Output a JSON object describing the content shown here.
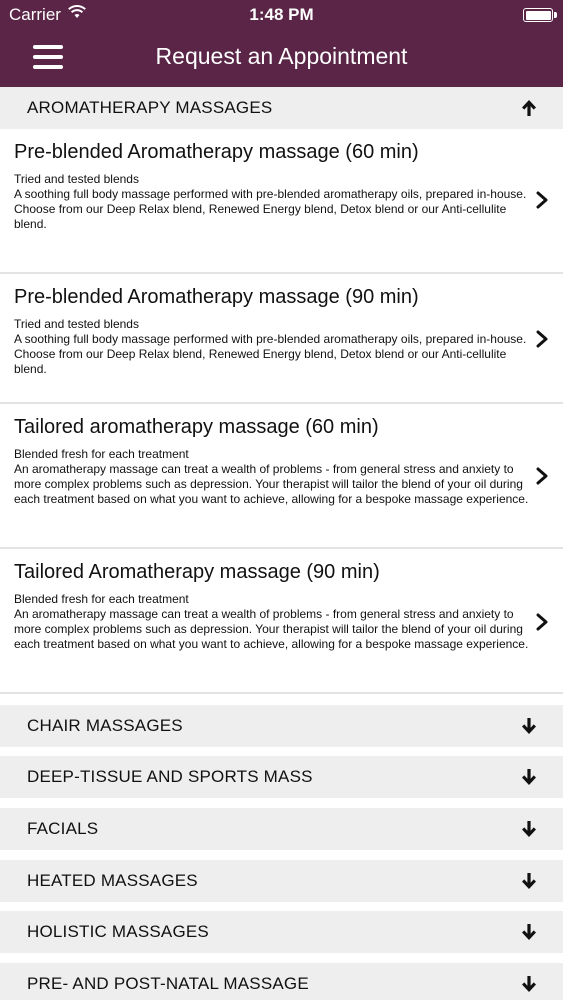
{
  "status_bar": {
    "carrier": "Carrier",
    "time": "1:48 PM",
    "wifi_icon": "wifi-icon",
    "battery_icon": "battery-icon"
  },
  "nav": {
    "title": "Request an Appointment",
    "menu_icon": "hamburger-menu-icon",
    "background_color": "#5a2547"
  },
  "expanded_category": {
    "label": "AROMATHERAPY MASSAGES",
    "icon": "arrow-up-icon",
    "items": [
      {
        "name": "Pre-blended Aromatherapy massage (60 min)",
        "subtitle": "Tried and tested blends",
        "description": " A soothing full body massage performed with pre-blended aromatherapy oils, prepared in-house. Choose from our Deep Relax blend, Renewed Energy blend, Detox blend or our Anti-cellulite blend."
      },
      {
        "name": "Pre-blended Aromatherapy massage (90 min)",
        "subtitle": "Tried and tested blends",
        "description": " A soothing full body massage performed with pre-blended aromatherapy oils, prepared in-house. Choose from our Deep Relax blend, Renewed Energy blend, Detox blend or our Anti-cellulite blend."
      },
      {
        "name": "Tailored aromatherapy massage (60 min)",
        "subtitle": "Blended fresh for each treatment",
        "description": " An aromatherapy massage can treat a wealth of problems - from general stress and anxiety to more complex problems such as depression. Your therapist will tailor the blend of your oil during each treatment based on what you want to achieve, allowing for a bespoke massage experience."
      },
      {
        "name": "Tailored Aromatherapy massage (90 min)",
        "subtitle": "Blended fresh for each treatment",
        "description": " An aromatherapy massage can treat a wealth of problems - from general stress and anxiety to more complex problems such as depression. Your therapist will tailor the blend of your oil during each treatment based on what you want to achieve, allowing for a bespoke massage experience."
      }
    ]
  },
  "collapsed_categories": [
    {
      "label": "CHAIR MASSAGES",
      "icon": "arrow-down-icon"
    },
    {
      "label": "DEEP-TISSUE AND SPORTS MASS",
      "icon": "arrow-down-icon"
    },
    {
      "label": "FACIALS",
      "icon": "arrow-down-icon"
    },
    {
      "label": "HEATED MASSAGES",
      "icon": "arrow-down-icon"
    },
    {
      "label": "HOLISTIC MASSAGES",
      "icon": "arrow-down-icon"
    },
    {
      "label": "PRE- AND POST-NATAL MASSAGE",
      "icon": "arrow-down-icon"
    }
  ]
}
